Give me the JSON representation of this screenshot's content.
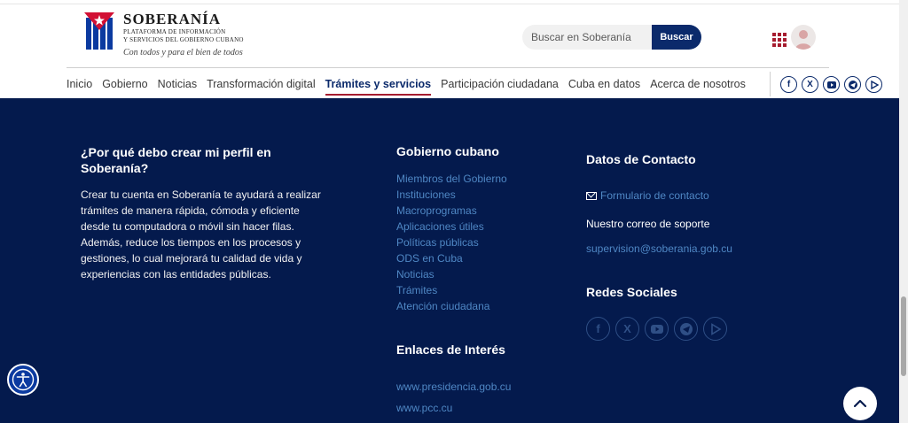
{
  "header": {
    "brand_name": "SOBERANÍA",
    "brand_sub_1": "Plataforma de Información",
    "brand_sub_2": "y Servicios del Gobierno Cubano",
    "tagline": "Con todos y para el bien de todos",
    "search_placeholder": "Buscar en Soberanía",
    "search_button": "Buscar"
  },
  "nav": {
    "items": [
      {
        "label": "Inicio"
      },
      {
        "label": "Gobierno"
      },
      {
        "label": "Noticias"
      },
      {
        "label": "Transformación digital"
      },
      {
        "label": "Trámites y servicios"
      },
      {
        "label": "Participación ciudadana"
      },
      {
        "label": "Cuba en datos"
      },
      {
        "label": "Acerca de nosotros"
      }
    ],
    "active": "Trámites y servicios"
  },
  "social_icons": [
    "facebook-icon",
    "x-icon",
    "youtube-icon",
    "telegram-icon",
    "ivoox-icon"
  ],
  "footer": {
    "why": {
      "title": "¿Por qué debo crear mi perfil en Soberanía?",
      "text": "Crear tu cuenta en Soberanía te ayudará a realizar trámites de manera rápida, cómoda y eficiente desde tu computadora o móvil sin hacer filas. Además, reduce los tiempos en los procesos y gestiones, lo cual mejorará tu calidad de vida y experiencias con las entidades públicas."
    },
    "gobierno": {
      "title": "Gobierno cubano",
      "links": [
        "Miembros del Gobierno",
        "Instituciones",
        "Macroprogramas",
        "Aplicaciones útiles",
        "Políticas públicas",
        "ODS en Cuba",
        "Noticias",
        "Trámites",
        "Atención ciudadana"
      ]
    },
    "enlaces": {
      "title": "Enlaces de Interés",
      "links": [
        "www.presidencia.gob.cu",
        "www.pcc.cu"
      ]
    },
    "contacto": {
      "title": "Datos de Contacto",
      "form_link": "Formulario de contacto",
      "support_label": "Nuestro correo de soporte",
      "support_email": "supervision@soberania.gob.cu"
    },
    "redes": {
      "title": "Redes Sociales"
    }
  },
  "colors": {
    "navy": "#041a4d",
    "accent_red": "#a61c2f",
    "link_blue": "#4f87c4",
    "button_blue": "#0b2a6b"
  }
}
